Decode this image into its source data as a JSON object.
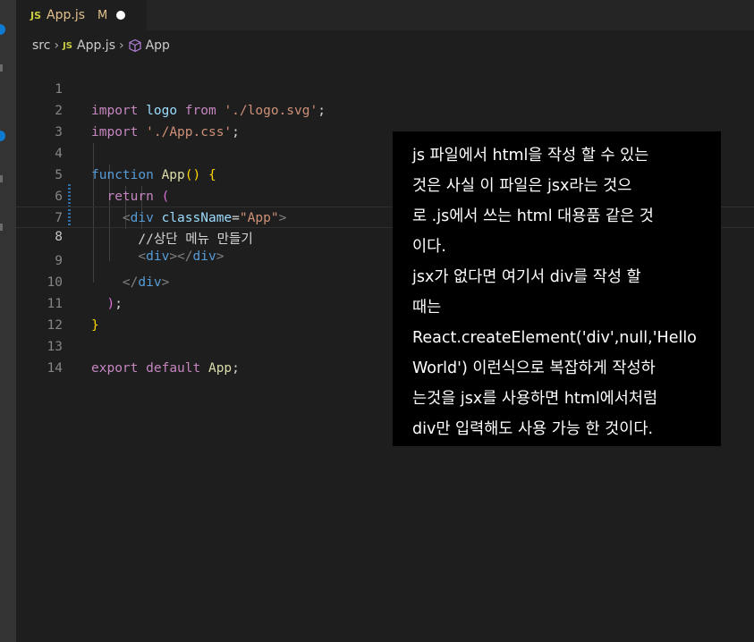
{
  "tab": {
    "badge": "JS",
    "name": "App.js",
    "modified": "M"
  },
  "breadcrumb": {
    "folder": "src",
    "file_badge": "JS",
    "file": "App.js",
    "symbol": "App",
    "symbol_icon": "cube-icon"
  },
  "editor": {
    "line_numbers": [
      "1",
      "2",
      "3",
      "4",
      "5",
      "6",
      "7",
      "8",
      "9",
      "10",
      "11",
      "12",
      "13",
      "14"
    ],
    "active_line": "8"
  },
  "note": {
    "lines": [
      "js 파일에서 html을 작성 할 수 있는",
      "것은 사실 이 파일은 jsx라는 것으",
      "로 .js에서 쓰는 html 대용품 같은 것",
      "이다.",
      "jsx가 없다면 여기서 div를 작성 할",
      "때는",
      "React.createElement('div',null,'Hello",
      "World') 이런식으로 복잡하게 작성하",
      "는것을 jsx를 사용하면 html에서처럼",
      "div만 입력해도 사용 가능 한 것이다."
    ]
  },
  "colors": {
    "editor_bg": "#1e1e1e",
    "keyword": "#c586c0",
    "string": "#ce9178",
    "function": "#dcdcaa"
  }
}
